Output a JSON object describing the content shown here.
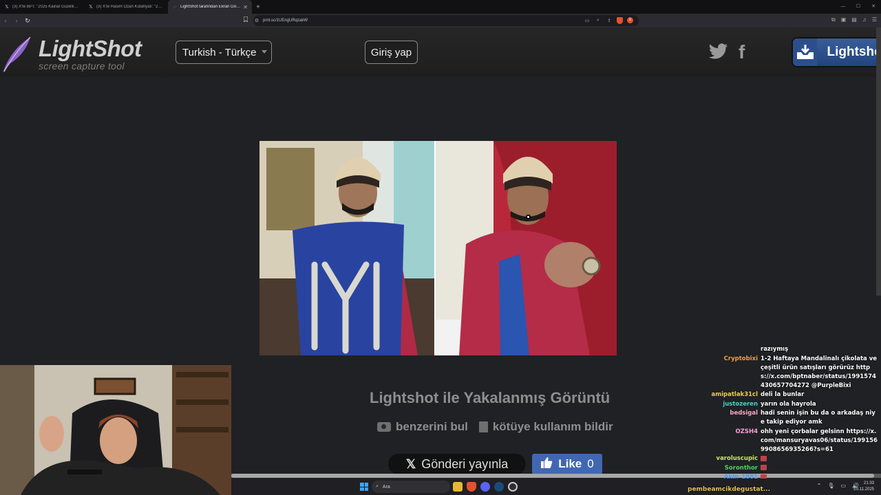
{
  "browser": {
    "tabs": [
      {
        "title": "(3) X'te BPT: \"2025 Kainat Güzellik Ya...",
        "active": false
      },
      {
        "title": "(3) X'te Rasim Ozan Kütahyalı: \"2025...",
        "active": false
      },
      {
        "title": "LightShot tarafından Ekran Görü...",
        "active": true
      }
    ],
    "url": "prnt.sc/1UEngURqzakW",
    "shield_count": "6"
  },
  "header": {
    "logo_title": "LightShot",
    "logo_subtitle": "screen capture tool",
    "language": "Turkish - Türkçe",
    "login_label": "Giriş yap",
    "download_label": "Lightshot"
  },
  "main": {
    "caption": "Lightshot ile Yakalanmış Görüntü",
    "find_similar": "benzerini bul",
    "report_abuse": "kötüye kullanım bildir",
    "share_x": "Gönderi yayınla",
    "like_label": "Like",
    "like_count": "0"
  },
  "chat": {
    "messages": [
      {
        "user": "",
        "color": "#ffffff",
        "text": "razıymış"
      },
      {
        "user": "Cryptobixi",
        "color": "#f0a030",
        "text": "1-2 Haftaya Mandalinalı çikolata ve çeşitli ürün satışları görürüz https://x.com/bptnaber/status/1991574430657704272 @PurpleBixi"
      },
      {
        "user": "amipatlak31cl",
        "color": "#e8d040",
        "text": "deli la bunlar"
      },
      {
        "user": "justozeren",
        "color": "#3fd3c8",
        "text": "yarın ola hayrola"
      },
      {
        "user": "bedsigal",
        "color": "#f7a8c8",
        "text": "hadi senin işin bu da o arkadaş niye takip ediyor amk"
      },
      {
        "user": "OZSH4",
        "color": "#f4a0d8",
        "text": "ohh yeni çorbalar gelsinn https://x.com/mansuryavas06/status/1991569908656935266?s=61"
      },
      {
        "user": "varoluscupic",
        "color": "#cce860",
        "text": ""
      },
      {
        "user": "Soronthor",
        "color": "#50d060",
        "text": ""
      },
      {
        "user": "Akin_1881",
        "color": "#4a9df0",
        "text": ""
      }
    ]
  },
  "taskbar": {
    "search_placeholder": "Ara",
    "time": "21:33",
    "date": "20.11.2025",
    "stream_user": "pembeamcikdegustat..."
  }
}
